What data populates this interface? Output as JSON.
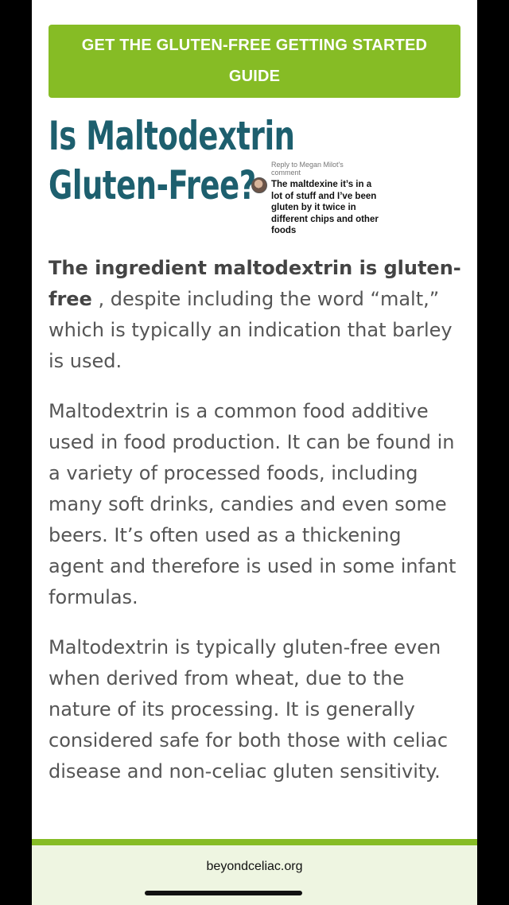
{
  "cta": {
    "label": "GET THE GLUTEN-FREE GETTING STARTED GUIDE"
  },
  "article": {
    "title": "Is Maltodextrin Gluten-Free?",
    "p1_bold": "The ingredient maltodextrin is gluten-free",
    "p1_rest": " , despite including the word “malt,” which is typically an indication that barley is used.",
    "p2": "Maltodextrin is a common food additive used in food production. It can be found in a variety of processed foods, including many soft drinks, candies and even some beers. It’s often used as a thickening agent and therefore is used in some infant formulas.",
    "p3": "Maltodextrin is typically gluten-free even when derived from wheat, due to the nature of its processing. It is generally considered safe for both those with celiac disease and non-celiac gluten sensitivity."
  },
  "comment_overlay": {
    "meta": "Reply to Megan Milot's comment",
    "text": "The maltdexine it’s in a lot of stuff and I’ve been gluten by it twice in different chips and other foods"
  },
  "footer": {
    "url": "beyondceliac.org"
  },
  "colors": {
    "accent": "#86bc25",
    "title": "#1d5f6e",
    "footer_bg": "#eef5e1"
  }
}
